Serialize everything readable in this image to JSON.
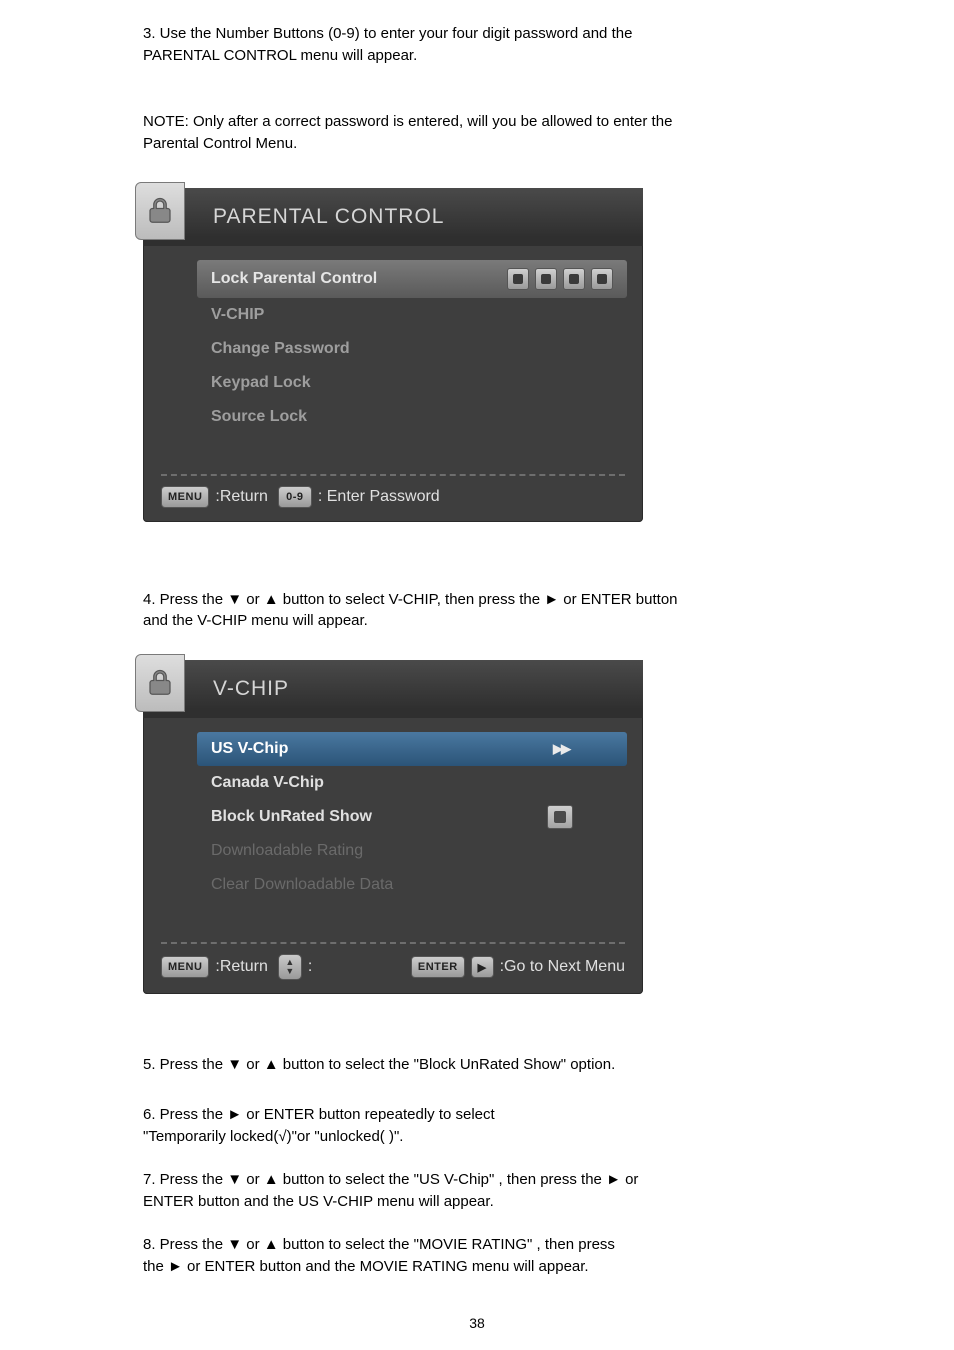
{
  "steps": {
    "s3_a": "3. Use the Number Buttons (0-9) to enter your four digit password and the",
    "s3_b": "PARENTAL CONTROL menu will appear.",
    "s3_note_a": "NOTE: Only after a correct password is entered, will you be allowed to enter the",
    "s3_note_b": "Parental Control Menu.",
    "s4_a": "4. Press the ▼ or ▲ button to select V-CHIP, then press the ► or ENTER button",
    "s4_b": "and the V-CHIP menu will appear.",
    "s5": "5. Press the ▼ or ▲ button to select the \"Block UnRated Show\" option.",
    "s6_a": "6. Press the ► or ENTER button repeatedly to select",
    "s6_b": "\"Temporarily locked(√)\"or \"unlocked( )\".",
    "s7_a": "7. Press the ▼ or ▲ button to select the \"US V-Chip\" , then press the ► or",
    "s7_b": "ENTER button and the US V-CHIP menu will appear.",
    "s8_a": "8. Press the ▼ or ▲ button to select the \"MOVIE RATING\" , then press",
    "s8_b": "the   ► or ENTER button and the MOVIE RATING menu will appear."
  },
  "osd1": {
    "title": "PARENTAL CONTROL",
    "items": {
      "lock": "Lock Parental Control",
      "vchip": "V-CHIP",
      "change": "Change Password",
      "keypad": "Keypad Lock",
      "source": "Source Lock"
    },
    "footer": {
      "menu_key": "MENU",
      "return": ":Return",
      "numkey": "0-9",
      "enterpw": ": Enter Password"
    }
  },
  "osd2": {
    "title": "V-CHIP",
    "items": {
      "us": "US V-Chip",
      "canada": "Canada V-Chip",
      "block": "Block UnRated Show",
      "downloadable": "Downloadable Rating",
      "clear": "Clear Downloadable Data"
    },
    "footer": {
      "menu_key": "MENU",
      "return": ":Return",
      "colon": ":",
      "enter_key": "ENTER",
      "play_key": "▶",
      "go_next": ":Go to Next Menu"
    }
  },
  "page_number": "38"
}
